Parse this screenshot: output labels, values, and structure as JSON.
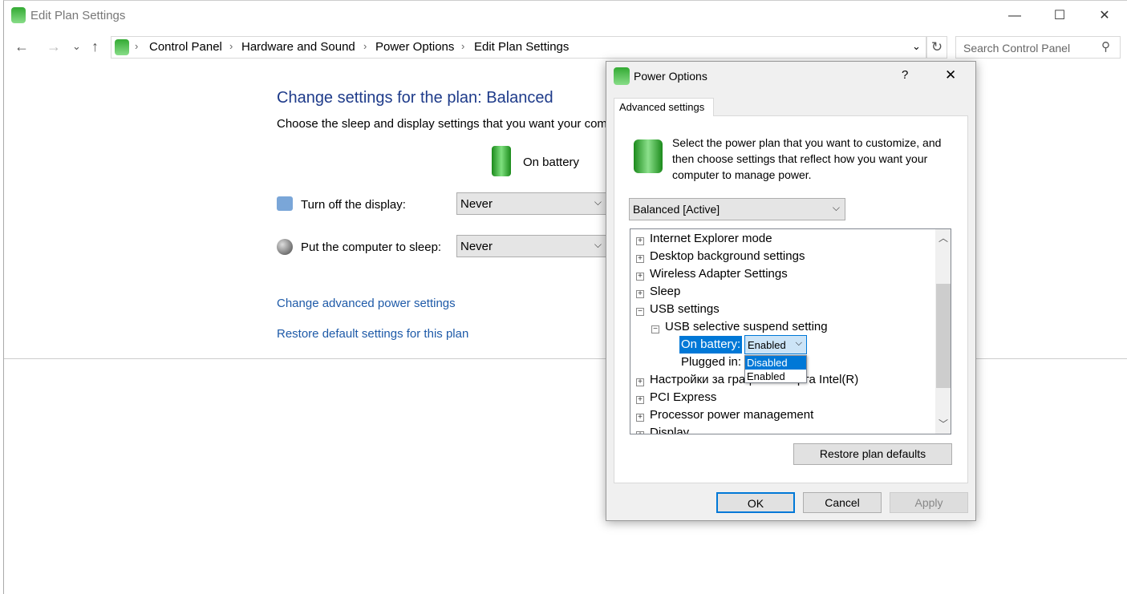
{
  "window": {
    "title": "Edit Plan Settings",
    "minimize": "—",
    "maximize": "☐",
    "close": "✕"
  },
  "nav": {
    "back": "←",
    "forward": "→",
    "recent": "⌄",
    "up": "↑",
    "breadcrumb": [
      "Control Panel",
      "Hardware and Sound",
      "Power Options",
      "Edit Plan Settings"
    ],
    "refresh": "↻",
    "dropdown": "⌄",
    "search_placeholder": "Search Control Panel"
  },
  "main": {
    "heading": "Change settings for the plan: Balanced",
    "subtitle": "Choose the sleep and display settings that you want your computer to use.",
    "column": "On battery",
    "display_label": "Turn off the display:",
    "display_value": "Never",
    "sleep_label": "Put the computer to sleep:",
    "sleep_value": "Never",
    "advanced_link": "Change advanced power settings",
    "restore_link": "Restore default settings for this plan"
  },
  "dialog": {
    "title": "Power Options",
    "help": "?",
    "close": "✕",
    "tab": "Advanced settings",
    "description": "Select the power plan that you want to customize, and then choose settings that reflect how you want your computer to manage power.",
    "plan": "Balanced [Active]",
    "tree": [
      {
        "label": "Internet Explorer mode",
        "state": "+"
      },
      {
        "label": "Desktop background settings",
        "state": "+"
      },
      {
        "label": "Wireless Adapter Settings",
        "state": "+"
      },
      {
        "label": "Sleep",
        "state": "+"
      },
      {
        "label": "USB settings",
        "state": "−"
      },
      {
        "label": "USB selective suspend setting",
        "state": "−"
      },
      {
        "label": "On battery:"
      },
      {
        "label": "Plugged in:"
      },
      {
        "label": "Настройки за графична карта Intel(R)",
        "state": "+"
      },
      {
        "label": "PCI Express",
        "state": "+"
      },
      {
        "label": "Processor power management",
        "state": "+"
      },
      {
        "label": "Display",
        "state": "+"
      }
    ],
    "on_battery_value": "Enabled",
    "options": [
      "Disabled",
      "Enabled"
    ],
    "restore": "Restore plan defaults",
    "ok": "OK",
    "cancel": "Cancel",
    "apply": "Apply"
  },
  "colors": {
    "accent": "#0078d7",
    "heading": "#1e3b8a",
    "link": "#1e5aa8"
  }
}
